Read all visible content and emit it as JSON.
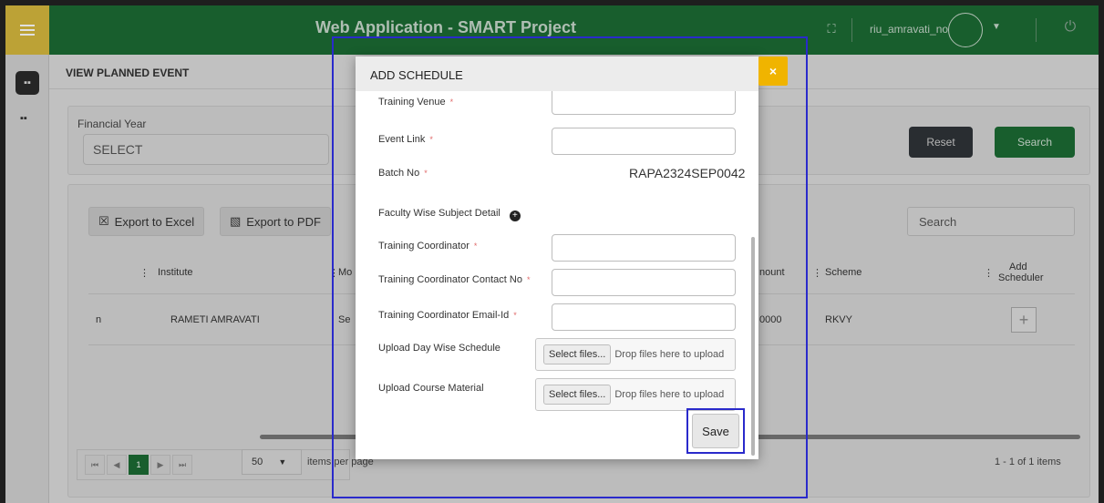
{
  "app": {
    "title": "Web Application - SMART Project",
    "username": "riu_amravati_no",
    "fullscreen_icon": "expand-icon",
    "power_icon": "power-icon"
  },
  "page": {
    "title": "VIEW PLANNED EVENT"
  },
  "filters": {
    "financial_year_label": "Financial Year",
    "financial_year_value": "SELECT",
    "reset_label": "Reset",
    "search_label": "Search"
  },
  "grid": {
    "export_excel_label": "Export to Excel",
    "export_pdf_label": "Export to PDF",
    "search_placeholder": "Search",
    "columns": {
      "institute": "Institute",
      "mode": "Mo",
      "amount": "nount",
      "scheme": "Scheme",
      "add_scheduler_line1": "Add",
      "add_scheduler_line2": "Scheduler"
    },
    "row": {
      "first": "n",
      "institute": "RAMETI AMRAVATI",
      "mode": "Se",
      "amount": "0000",
      "scheme": "RKVY"
    },
    "pager": {
      "current_page": "1",
      "page_size": "50",
      "items_per_page": "items per page",
      "items_count": "1 - 1 of 1 items"
    }
  },
  "modal": {
    "title": "ADD SCHEDULE",
    "close_label": "×",
    "training_venue_label": "Training Venue",
    "event_link_label": "Event Link",
    "batch_no_label": "Batch No",
    "batch_no_value": "RAPA2324SEP0042",
    "faculty_label": "Faculty Wise Subject Detail",
    "coordinator_label": "Training Coordinator",
    "coordinator_contact_label": "Training Coordinator Contact No",
    "coordinator_email_label": "Training Coordinator Email-Id",
    "day_schedule_label": "Upload Day Wise Schedule",
    "course_material_label": "Upload Course Material",
    "select_files_label": "Select files...",
    "drop_files_label": "Drop files here to upload",
    "required_mark": "*",
    "save_label": "Save"
  }
}
